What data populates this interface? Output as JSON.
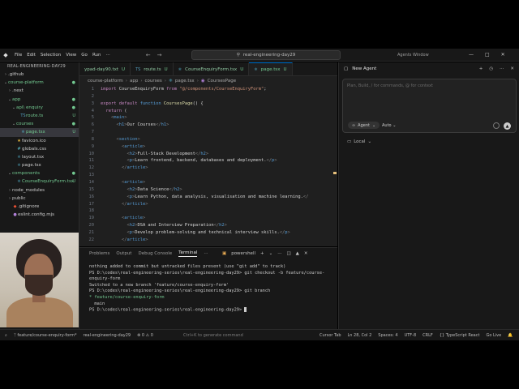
{
  "titlebar": {
    "menu": [
      "File",
      "Edit",
      "Selection",
      "View",
      "Go",
      "Run",
      "···"
    ],
    "search": "real-engineering-day29",
    "agents_window": "Agents Window"
  },
  "explorer": {
    "title": "REAL-ENGINEERING-DAY29",
    "items": [
      {
        "label": ".github",
        "type": "folder",
        "open": false,
        "depth": 0
      },
      {
        "label": "course-platform",
        "type": "folder",
        "open": true,
        "depth": 0,
        "badge": "●"
      },
      {
        "label": ".next",
        "type": "folder",
        "open": false,
        "depth": 1
      },
      {
        "label": "app",
        "type": "folder",
        "open": true,
        "depth": 1,
        "badge": "●"
      },
      {
        "label": "api\\ enquiry",
        "type": "folder",
        "open": true,
        "depth": 2,
        "badge": "●"
      },
      {
        "label": "route.ts",
        "type": "ts",
        "depth": 3,
        "badge": "U"
      },
      {
        "label": "courses",
        "type": "folder",
        "open": true,
        "depth": 2,
        "badge": "●"
      },
      {
        "label": "page.tsx",
        "type": "tsx",
        "depth": 3,
        "badge": "U",
        "selected": true
      },
      {
        "label": "favicon.ico",
        "type": "ico",
        "depth": 2
      },
      {
        "label": "globals.css",
        "type": "css",
        "depth": 2
      },
      {
        "label": "layout.tsx",
        "type": "tsx",
        "depth": 2
      },
      {
        "label": "page.tsx",
        "type": "tsx",
        "depth": 2
      },
      {
        "label": "components",
        "type": "folder",
        "open": true,
        "depth": 1,
        "badge": "●"
      },
      {
        "label": "CourseEnquiryForm.tsx",
        "type": "tsx",
        "depth": 2,
        "badge": "U"
      },
      {
        "label": "node_modules",
        "type": "folder",
        "open": false,
        "depth": 1
      },
      {
        "label": "public",
        "type": "folder",
        "open": false,
        "depth": 1
      },
      {
        "label": ".gitignore",
        "type": "git",
        "depth": 1
      },
      {
        "label": "eslint.config.mjs",
        "type": "js",
        "depth": 1
      }
    ]
  },
  "tabs": [
    {
      "label": "ypad-day90.txt",
      "badge": "U",
      "icon": "",
      "active": false
    },
    {
      "label": "route.ts",
      "badge": "U",
      "icon": "TS",
      "active": false
    },
    {
      "label": "CourseEnquiryForm.tsx",
      "badge": "U",
      "icon": "⚛",
      "active": false
    },
    {
      "label": "page.tsx",
      "badge": "U",
      "icon": "⚛",
      "active": true
    }
  ],
  "breadcrumb": [
    "course-platform",
    "app",
    "courses",
    "page.tsx",
    "CoursesPage"
  ],
  "code": [
    {
      "n": "1",
      "parts": [
        [
          "kw",
          "import "
        ],
        [
          "txtc",
          "CourseEnquiryForm "
        ],
        [
          "kw",
          "from "
        ],
        [
          "str",
          "\"@/components/CourseEnquiryForm\""
        ],
        [
          "txtc",
          ";"
        ]
      ]
    },
    {
      "n": "2",
      "parts": []
    },
    {
      "n": "3",
      "parts": [
        [
          "kw",
          "export default "
        ],
        [
          "kw2",
          "function "
        ],
        [
          "fn",
          "CoursesPage"
        ],
        [
          "txtc",
          "() {"
        ]
      ]
    },
    {
      "n": "4",
      "parts": [
        [
          "txtc",
          "  "
        ],
        [
          "kw",
          "return "
        ],
        [
          "txtc",
          "("
        ]
      ]
    },
    {
      "n": "5",
      "parts": [
        [
          "br",
          "    <"
        ],
        [
          "tag",
          "main"
        ],
        [
          "br",
          ">"
        ]
      ]
    },
    {
      "n": "6",
      "parts": [
        [
          "br",
          "      <"
        ],
        [
          "tag",
          "h1"
        ],
        [
          "br",
          ">"
        ],
        [
          "txtc",
          "Our Courses"
        ],
        [
          "br",
          "</"
        ],
        [
          "tag",
          "h1"
        ],
        [
          "br",
          ">"
        ]
      ]
    },
    {
      "n": "7",
      "parts": []
    },
    {
      "n": "8",
      "parts": [
        [
          "br",
          "      <"
        ],
        [
          "tag",
          "section"
        ],
        [
          "br",
          ">"
        ]
      ]
    },
    {
      "n": "9",
      "parts": [
        [
          "br",
          "        <"
        ],
        [
          "tag",
          "article"
        ],
        [
          "br",
          ">"
        ]
      ]
    },
    {
      "n": "10",
      "parts": [
        [
          "br",
          "          <"
        ],
        [
          "tag",
          "h2"
        ],
        [
          "br",
          ">"
        ],
        [
          "txtc",
          "Full-Stack Development"
        ],
        [
          "br",
          "</"
        ],
        [
          "tag",
          "h2"
        ],
        [
          "br",
          ">"
        ]
      ]
    },
    {
      "n": "11",
      "parts": [
        [
          "br",
          "          <"
        ],
        [
          "tag",
          "p"
        ],
        [
          "br",
          ">"
        ],
        [
          "txtc",
          "Learn frontend, backend, databases and deployment."
        ],
        [
          "br",
          "</"
        ],
        [
          "tag",
          "p"
        ],
        [
          "br",
          ">"
        ]
      ]
    },
    {
      "n": "12",
      "parts": [
        [
          "br",
          "        </"
        ],
        [
          "tag",
          "article"
        ],
        [
          "br",
          ">"
        ]
      ]
    },
    {
      "n": "13",
      "parts": []
    },
    {
      "n": "14",
      "parts": [
        [
          "br",
          "        <"
        ],
        [
          "tag",
          "article"
        ],
        [
          "br",
          ">"
        ]
      ]
    },
    {
      "n": "15",
      "parts": [
        [
          "br",
          "          <"
        ],
        [
          "tag",
          "h2"
        ],
        [
          "br",
          ">"
        ],
        [
          "txtc",
          "Data Science"
        ],
        [
          "br",
          "</"
        ],
        [
          "tag",
          "h2"
        ],
        [
          "br",
          ">"
        ]
      ]
    },
    {
      "n": "16",
      "parts": [
        [
          "br",
          "          <"
        ],
        [
          "tag",
          "p"
        ],
        [
          "br",
          ">"
        ],
        [
          "txtc",
          "Learn Python, data analysis, visualisation and machine learning."
        ],
        [
          "br",
          "</"
        ]
      ]
    },
    {
      "n": "17",
      "parts": [
        [
          "br",
          "        </"
        ],
        [
          "tag",
          "article"
        ],
        [
          "br",
          ">"
        ]
      ]
    },
    {
      "n": "18",
      "parts": []
    },
    {
      "n": "19",
      "parts": [
        [
          "br",
          "        <"
        ],
        [
          "tag",
          "article"
        ],
        [
          "br",
          ">"
        ]
      ]
    },
    {
      "n": "20",
      "parts": [
        [
          "br",
          "          <"
        ],
        [
          "tag",
          "h2"
        ],
        [
          "br",
          ">"
        ],
        [
          "txtc",
          "DSA and Interview Preparation"
        ],
        [
          "br",
          "</"
        ],
        [
          "tag",
          "h2"
        ],
        [
          "br",
          ">"
        ]
      ]
    },
    {
      "n": "21",
      "parts": [
        [
          "br",
          "          <"
        ],
        [
          "tag",
          "p"
        ],
        [
          "br",
          ">"
        ],
        [
          "txtc",
          "Develop problem-solving and technical interview skills."
        ],
        [
          "br",
          "</"
        ],
        [
          "tag",
          "p"
        ],
        [
          "br",
          ">"
        ]
      ]
    },
    {
      "n": "22",
      "parts": [
        [
          "br",
          "        </"
        ],
        [
          "tag",
          "article"
        ],
        [
          "br",
          ">"
        ]
      ]
    }
  ],
  "panel": {
    "tabs": [
      "Problems",
      "Output",
      "Debug Console",
      "Terminal",
      "···"
    ],
    "active_tab": "Terminal",
    "shell": "powershell",
    "terminal_lines": [
      {
        "text": "nothing added to commit but untracked files present (use \"git add\" to track)",
        "style": ""
      },
      {
        "text": "PS D:\\codes\\real-engineering-series\\real-engineering-day29> git checkout -b feature/course-",
        "style": ""
      },
      {
        "text": "enquiry-form",
        "style": ""
      },
      {
        "text": "Switched to a new branch 'feature/course-enquiry-form'",
        "style": ""
      },
      {
        "text": "PS D:\\codes\\real-engineering-series\\real-engineering-day29> git branch",
        "style": ""
      },
      {
        "text": "* feature/course-enquiry-form",
        "style": "green"
      },
      {
        "text": "  main",
        "style": ""
      },
      {
        "text": "PS D:\\codes\\real-engineering-series\\real-engineering-day29> ",
        "style": "",
        "cursor": true
      }
    ]
  },
  "agent": {
    "title": "New Agent",
    "placeholder": "Plan, Build, / for commands, @ for context",
    "mode": "Agent",
    "model": "Auto",
    "location": "Local"
  },
  "statusbar": {
    "branch": "feature/course-enquiry-form*",
    "workspace": "real-engineering-day29",
    "problems": "0",
    "warnings": "0",
    "hint": "Ctrl+K to generate command",
    "right": [
      "Cursor Tab",
      "Ln 28, Col 2",
      "Spaces: 4",
      "UTF-8",
      "CRLF",
      "{} TypeScript React",
      "Go Live"
    ]
  }
}
